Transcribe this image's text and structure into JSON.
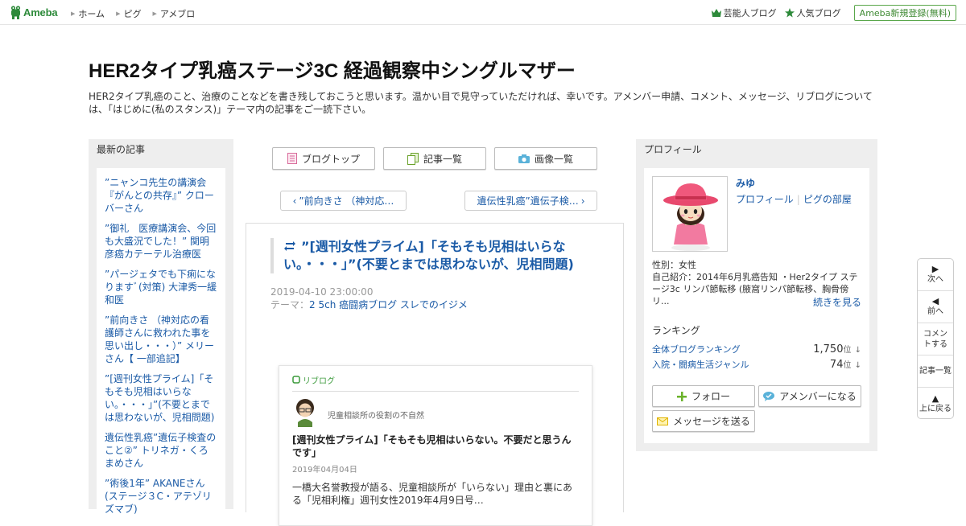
{
  "header": {
    "logo_text": "Ameba",
    "nav": [
      {
        "label": "ホーム"
      },
      {
        "label": "ピグ"
      },
      {
        "label": "アメブロ"
      }
    ],
    "right_links": [
      {
        "label": "芸能人ブログ",
        "icon": "crown-icon"
      },
      {
        "label": "人気ブログ",
        "icon": "star-icon"
      }
    ],
    "register_label": "Ameba新規登録(無料)"
  },
  "blog": {
    "title": "HER2タイプ乳癌ステージ3C 経過観察中シングルマザー",
    "description": "HER2タイプ乳癌のこと、治療のことなどを書き残しておこうと思います。温かい目で見守っていただければ、幸いです。アメンバー申請、コメント、メッセージ、リブログについては、「はじめに(私のスタンス)」テーマ内の記事をご一読下さい。"
  },
  "recent": {
    "heading": "最新の記事",
    "entries": [
      {
        "label": "”ニャンコ先生の講演会『がんとの共存』” クローバーさん"
      },
      {
        "label": "”御礼　医療講演会、今回も大盛況でした！” 関明彦癌カテーテル治療医"
      },
      {
        "label": "”パージェタでも下痢になりますﾞ(対策) 大津秀一緩和医"
      },
      {
        "label": "”前向きさ （神対応の看護師さんに救われた事を思い出し・・・）” メリーさん【 一部追記】"
      },
      {
        "label": "”[週刊女性プライム]「そもそも児相はいらない。・・・」”(不要とまでは思わないが、児相問題)"
      },
      {
        "label": "遺伝性乳癌”遺伝子検査のこと②” トリネガ・くろまめさん"
      },
      {
        "label": "”術後1年” AKANEさん (ステージ３C・アテゾリズマブ)"
      }
    ]
  },
  "main": {
    "tabs": [
      {
        "label": "ブログトップ",
        "icon": "document-icon"
      },
      {
        "label": "記事一覧",
        "icon": "copy-icon"
      },
      {
        "label": "画像一覧",
        "icon": "camera-icon"
      }
    ],
    "prev_label": "”前向きさ （神対応…",
    "next_label": "遺伝性乳癌”遺伝子検…",
    "article": {
      "title": "”[週刊女性プライム]「そもそも児相はいらない。・・・」”(不要とまでは思わないが、児相問題)",
      "datetime": "2019-04-10 23:00:00",
      "theme_prefix": "テーマ：",
      "theme": "2 5ch 癌闘病ブログ スレでのイジメ"
    },
    "reblog": {
      "tag": "リブログ",
      "user_caption": "児童相談所の役割の不自然",
      "title": "[週刊女性プライム]「そもそも児相はいらない。不要だと思うんです」",
      "date": "2019年04月04日",
      "body": "一橋大名誉教授が語る、児童相談所が「いらない」理由と裏にある「児相利権」週刊女性2019年4月9日号…"
    }
  },
  "profile": {
    "heading": "プロフィール",
    "name": "みゆ",
    "link_profile": "プロフィール",
    "link_pig": "ピグの部屋",
    "gender": "性別：女性",
    "intro": "自己紹介：2014年6月乳癌告知 ・Her2タイプ ステージ3c リンパ節転移 (腋窩リンパ節転移、胸骨傍リ...",
    "more_label": "続きを見る",
    "ranking_heading": "ランキング",
    "rankings": [
      {
        "label": "全体ブログランキング",
        "value": "1,750",
        "unit": "位",
        "trend": "↓"
      },
      {
        "label": "入院・闘病生活ジャンル",
        "value": "74",
        "unit": "位",
        "trend": "↓"
      }
    ],
    "follow_label": "フォロー",
    "amember_label": "アメンバーになる",
    "message_label": "メッセージを送る"
  },
  "side_nav": [
    {
      "arrow": "▶",
      "label": "次へ"
    },
    {
      "arrow": "◀",
      "label": "前へ"
    },
    {
      "arrow": "",
      "label": "コメントする"
    },
    {
      "arrow": "",
      "label": "記事一覧"
    },
    {
      "arrow": "▲",
      "label": "上に戻る"
    }
  ],
  "colors": {
    "link": "#1a5aa6",
    "brand_green": "#2d8a3a",
    "reblog_green": "#3b9a3b",
    "column_bg": "#eeeeee"
  }
}
